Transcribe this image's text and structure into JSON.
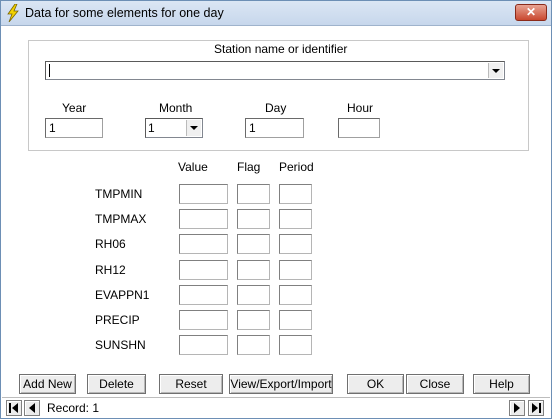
{
  "window": {
    "title": "Data for some elements for one day"
  },
  "station": {
    "label": "Station name or identifier",
    "value": ""
  },
  "date": {
    "year_label": "Year",
    "year_value": "1",
    "month_label": "Month",
    "month_value": "1",
    "day_label": "Day",
    "day_value": "1",
    "hour_label": "Hour",
    "hour_value": ""
  },
  "grid": {
    "headers": {
      "value": "Value",
      "flag": "Flag",
      "period": "Period"
    },
    "elements": [
      "TMPMIN",
      "TMPMAX",
      "RH06",
      "RH12",
      "EVAPPN1",
      "PRECIP",
      "SUNSHN"
    ]
  },
  "buttons": {
    "add_new": "Add New",
    "delete": "Delete",
    "reset": "Reset",
    "view_export": "View/Export/Import",
    "ok": "OK",
    "close": "Close",
    "help": "Help"
  },
  "navigation": {
    "record_text": "Record: 1"
  },
  "icons": {
    "app": "lightning-icon",
    "close": "close-icon",
    "dropdown": "chevron-down-icon",
    "first": "first-record-icon",
    "prev": "previous-record-icon",
    "next": "next-record-icon",
    "last": "last-record-icon"
  }
}
